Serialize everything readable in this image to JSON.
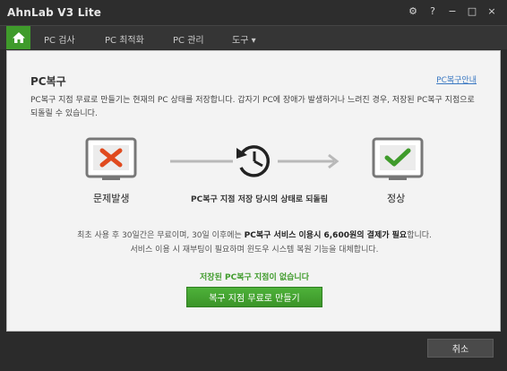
{
  "window": {
    "title": "AhnLab V3 Lite",
    "buttons": {
      "settings": "⚙",
      "help": "?",
      "minimize": "−",
      "maximize": "□",
      "close": "×"
    }
  },
  "menu": {
    "home_icon": "home-icon",
    "items": [
      {
        "label": "PC 검사"
      },
      {
        "label": "PC 최적화"
      },
      {
        "label": "PC 관리"
      },
      {
        "label": "도구 ▾"
      }
    ]
  },
  "page": {
    "title": "PC복구",
    "guide_link": "PC복구안내",
    "description": "PC복구 지점 무료로 만들기는 현재의 PC 상태를 저장합니다.  갑자기 PC에 장애가 발생하거나 느려진 경우, 저장된 PC복구 지점으로 되돌릴 수 있습니다.",
    "diagram": {
      "left_label": "문제발생",
      "center_label": "PC복구 지점 저장 당시의 상태로 되돌림",
      "right_label": "정상"
    },
    "info_line1_prefix": "최초 사용 후 30일간은 무료이며, 30일 이후에는 ",
    "info_line1_bold": "PC복구 서비스 이용시 6,600원의 결제가 필요",
    "info_line1_suffix": "합니다.",
    "info_line2": "서비스 이용 시 재부팅이 필요하며 윈도우 시스템 복원 기능을 대체합니다.",
    "warning": "저장된 PC복구 지점이 없습니다",
    "create_button": "복구 지점 무료로 만들기"
  },
  "footer": {
    "cancel_button": "취소"
  },
  "colors": {
    "accent_green": "#3f9b2b",
    "error_red": "#e04a1e",
    "link_blue": "#3a78c2"
  }
}
